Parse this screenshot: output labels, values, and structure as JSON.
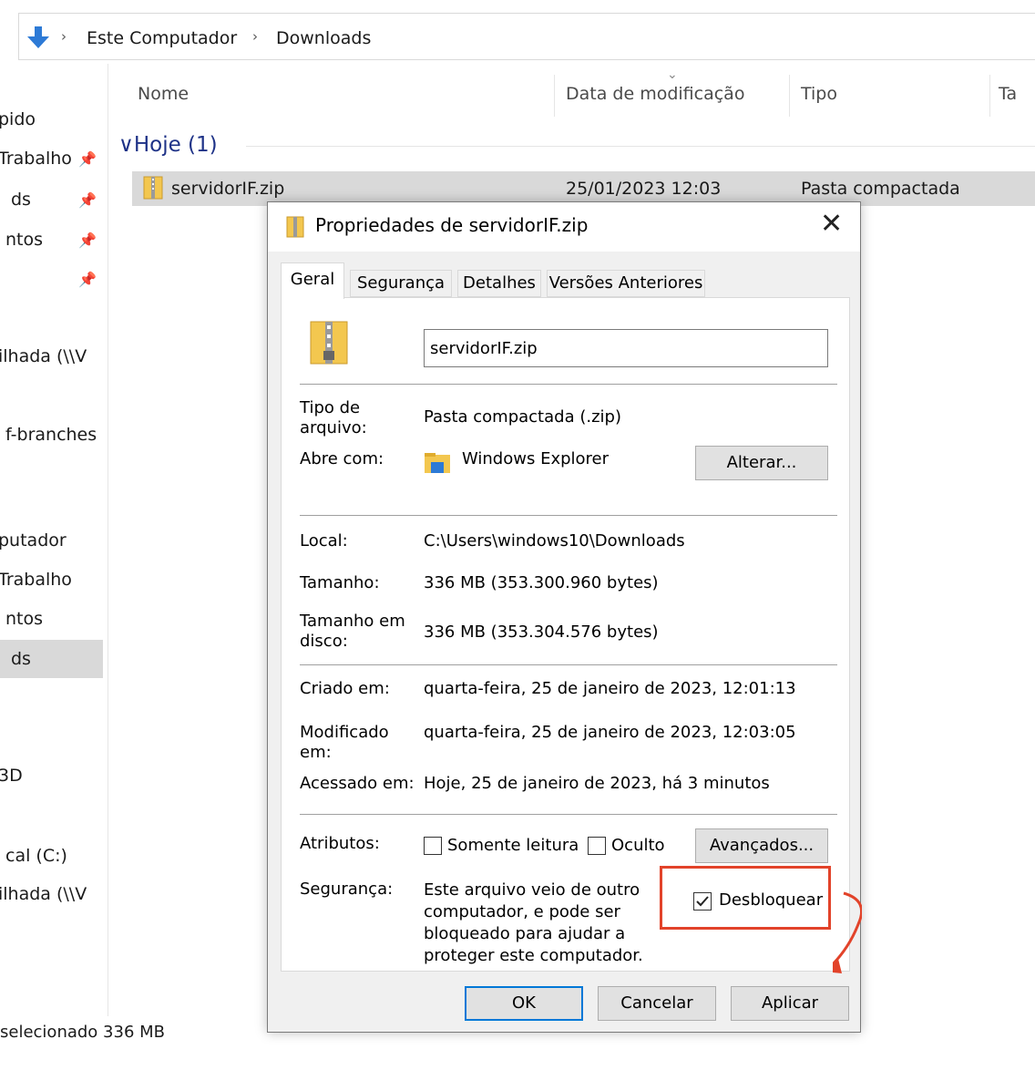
{
  "address": {
    "crumbs": [
      "Este Computador",
      "Downloads"
    ],
    "separator": "›"
  },
  "sidebar": {
    "items": [
      "pido",
      "Trabalho",
      "ds",
      "ntos",
      "ilhada (\\\\V",
      "f-branches",
      "putador",
      "Trabalho",
      "ntos",
      "ds",
      "3D",
      "cal (C:)",
      "ilhada (\\\\V"
    ],
    "pin_glyph": "📌"
  },
  "columns": {
    "name": "Nome",
    "date": "Data de modificação",
    "type": "Tipo",
    "size": "Ta"
  },
  "group": {
    "label": "Hoje (1)",
    "chevron": "∨"
  },
  "file_row": {
    "name": "servidorIF.zip",
    "date": "25/01/2023 12:03",
    "type": "Pasta compactada"
  },
  "dialog": {
    "title": "Propriedades de servidorIF.zip",
    "close": "✕",
    "tabs": [
      "Geral",
      "Segurança",
      "Detalhes",
      "Versões Anteriores"
    ],
    "file_name": "servidorIF.zip",
    "type_label": "Tipo de arquivo:",
    "type_value": "Pasta compactada (.zip)",
    "opens_label": "Abre com:",
    "opens_value": "Windows Explorer",
    "change_button": "Alterar...",
    "location_label": "Local:",
    "location_value": "C:\\Users\\windows10\\Downloads",
    "size_label": "Tamanho:",
    "size_value": "336 MB (353.300.960 bytes)",
    "disk_size_label": "Tamanho em disco:",
    "disk_size_value": "336 MB (353.304.576 bytes)",
    "created_label": "Criado em:",
    "created_value": "quarta-feira, 25 de janeiro de 2023, 12:01:13",
    "modified_label": "Modificado em:",
    "modified_value": "quarta-feira, 25 de janeiro de 2023, 12:03:05",
    "accessed_label": "Acessado em:",
    "accessed_value": "Hoje, 25 de janeiro de 2023, há 3 minutos",
    "attributes_label": "Atributos:",
    "readonly_label": "Somente leitura",
    "hidden_label": "Oculto",
    "advanced_button": "Avançados...",
    "security_label": "Segurança:",
    "security_text": "Este arquivo veio de outro computador, e pode ser bloqueado para ajudar a proteger este computador.",
    "unblock_label": "Desbloquear",
    "unblock_checked": true,
    "ok_button": "OK",
    "cancel_button": "Cancelar",
    "apply_button": "Aplicar"
  },
  "status_bar": {
    "text": "selecionado  336 MB"
  },
  "colors": {
    "accent_group": "#1e3287",
    "highlight": "#e2432a",
    "selection": "#d9d9d9",
    "zip_folder": "#f3c74f"
  }
}
